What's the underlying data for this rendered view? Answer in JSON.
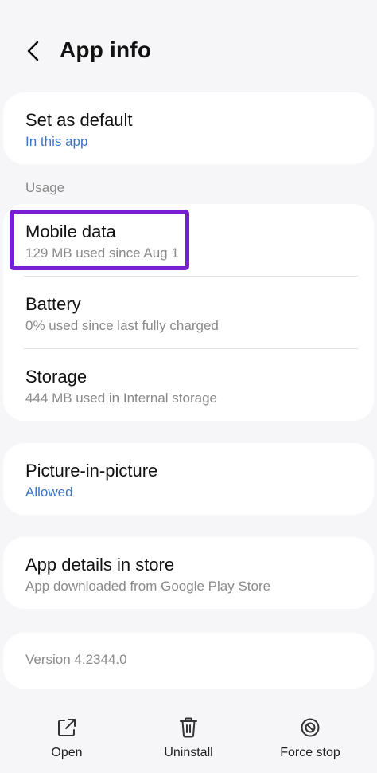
{
  "header": {
    "title": "App info",
    "back_icon": "chevron-left-icon"
  },
  "defaults": {
    "title": "Set as default",
    "subtitle": "In this app"
  },
  "usage": {
    "label": "Usage",
    "items": [
      {
        "title": "Mobile data",
        "subtitle": "129 MB used since Aug 1"
      },
      {
        "title": "Battery",
        "subtitle": "0% used since last fully charged"
      },
      {
        "title": "Storage",
        "subtitle": "444 MB used in Internal storage"
      }
    ]
  },
  "pip": {
    "title": "Picture-in-picture",
    "subtitle": "Allowed"
  },
  "store": {
    "title": "App details in store",
    "subtitle": "App downloaded from Google Play Store"
  },
  "version": {
    "text": "Version 4.2344.0"
  },
  "bottom_bar": {
    "open_label": "Open",
    "uninstall_label": "Uninstall",
    "force_stop_label": "Force stop"
  },
  "colors": {
    "background": "#f6f6f8",
    "card": "#ffffff",
    "link": "#3b73c8",
    "highlight": "#7a1ed6",
    "secondary_text": "#8a8a8a"
  }
}
